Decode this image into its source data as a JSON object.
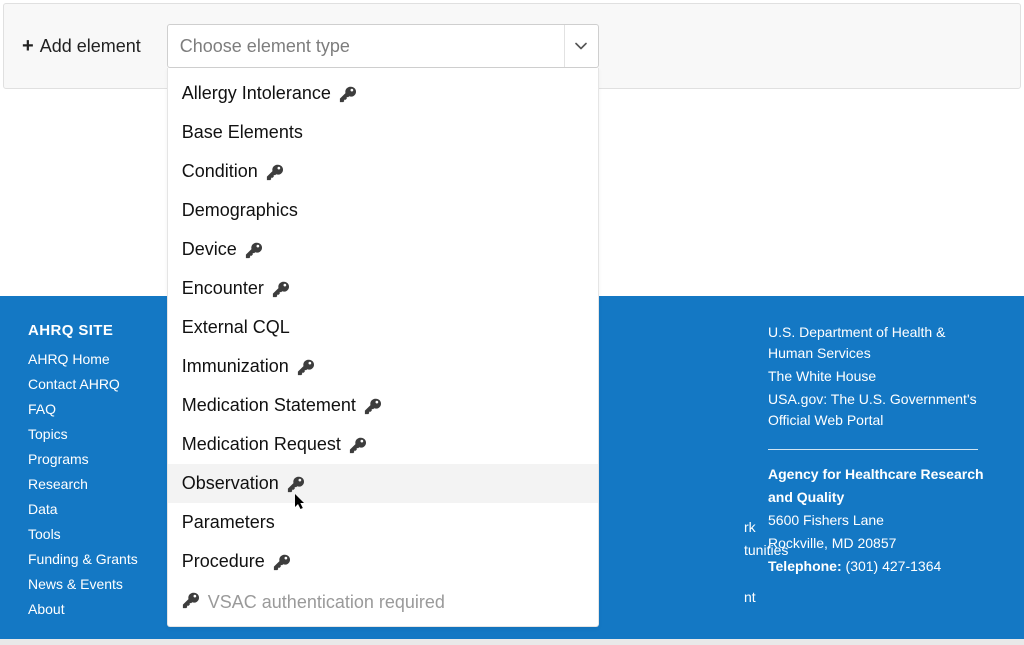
{
  "addElement": {
    "label": "Add element",
    "placeholder": "Choose element type",
    "options": [
      {
        "label": "Allergy Intolerance",
        "auth": true
      },
      {
        "label": "Base Elements",
        "auth": false
      },
      {
        "label": "Condition",
        "auth": true
      },
      {
        "label": "Demographics",
        "auth": false
      },
      {
        "label": "Device",
        "auth": true
      },
      {
        "label": "Encounter",
        "auth": true
      },
      {
        "label": "External CQL",
        "auth": false
      },
      {
        "label": "Immunization",
        "auth": true
      },
      {
        "label": "Medication Statement",
        "auth": true
      },
      {
        "label": "Medication Request",
        "auth": true
      },
      {
        "label": "Observation",
        "auth": true,
        "hovered": true
      },
      {
        "label": "Parameters",
        "auth": false
      },
      {
        "label": "Procedure",
        "auth": true
      }
    ],
    "authFooter": "VSAC authentication required"
  },
  "footer": {
    "leftHeading": "AHRQ SITE",
    "leftLinks": [
      "AHRQ Home",
      "Contact AHRQ",
      "FAQ",
      "Topics",
      "Programs",
      "Research",
      "Data",
      "Tools",
      "Funding & Grants",
      "News & Events",
      "About"
    ],
    "middleFragments": {
      "a": "rk",
      "b": "tunities",
      "c": "nt"
    },
    "right": {
      "links": [
        "U.S. Department of Health & Human Services",
        "The White House",
        "USA.gov: The U.S. Government's Official Web Portal"
      ],
      "agencyLine1": "Agency for Healthcare Research",
      "agencyLine2": "and Quality",
      "addr1": "5600 Fishers Lane",
      "addr2": "Rockville, MD 20857",
      "telLabel": "Telephone:",
      "telValue": "(301) 427-1364"
    }
  }
}
